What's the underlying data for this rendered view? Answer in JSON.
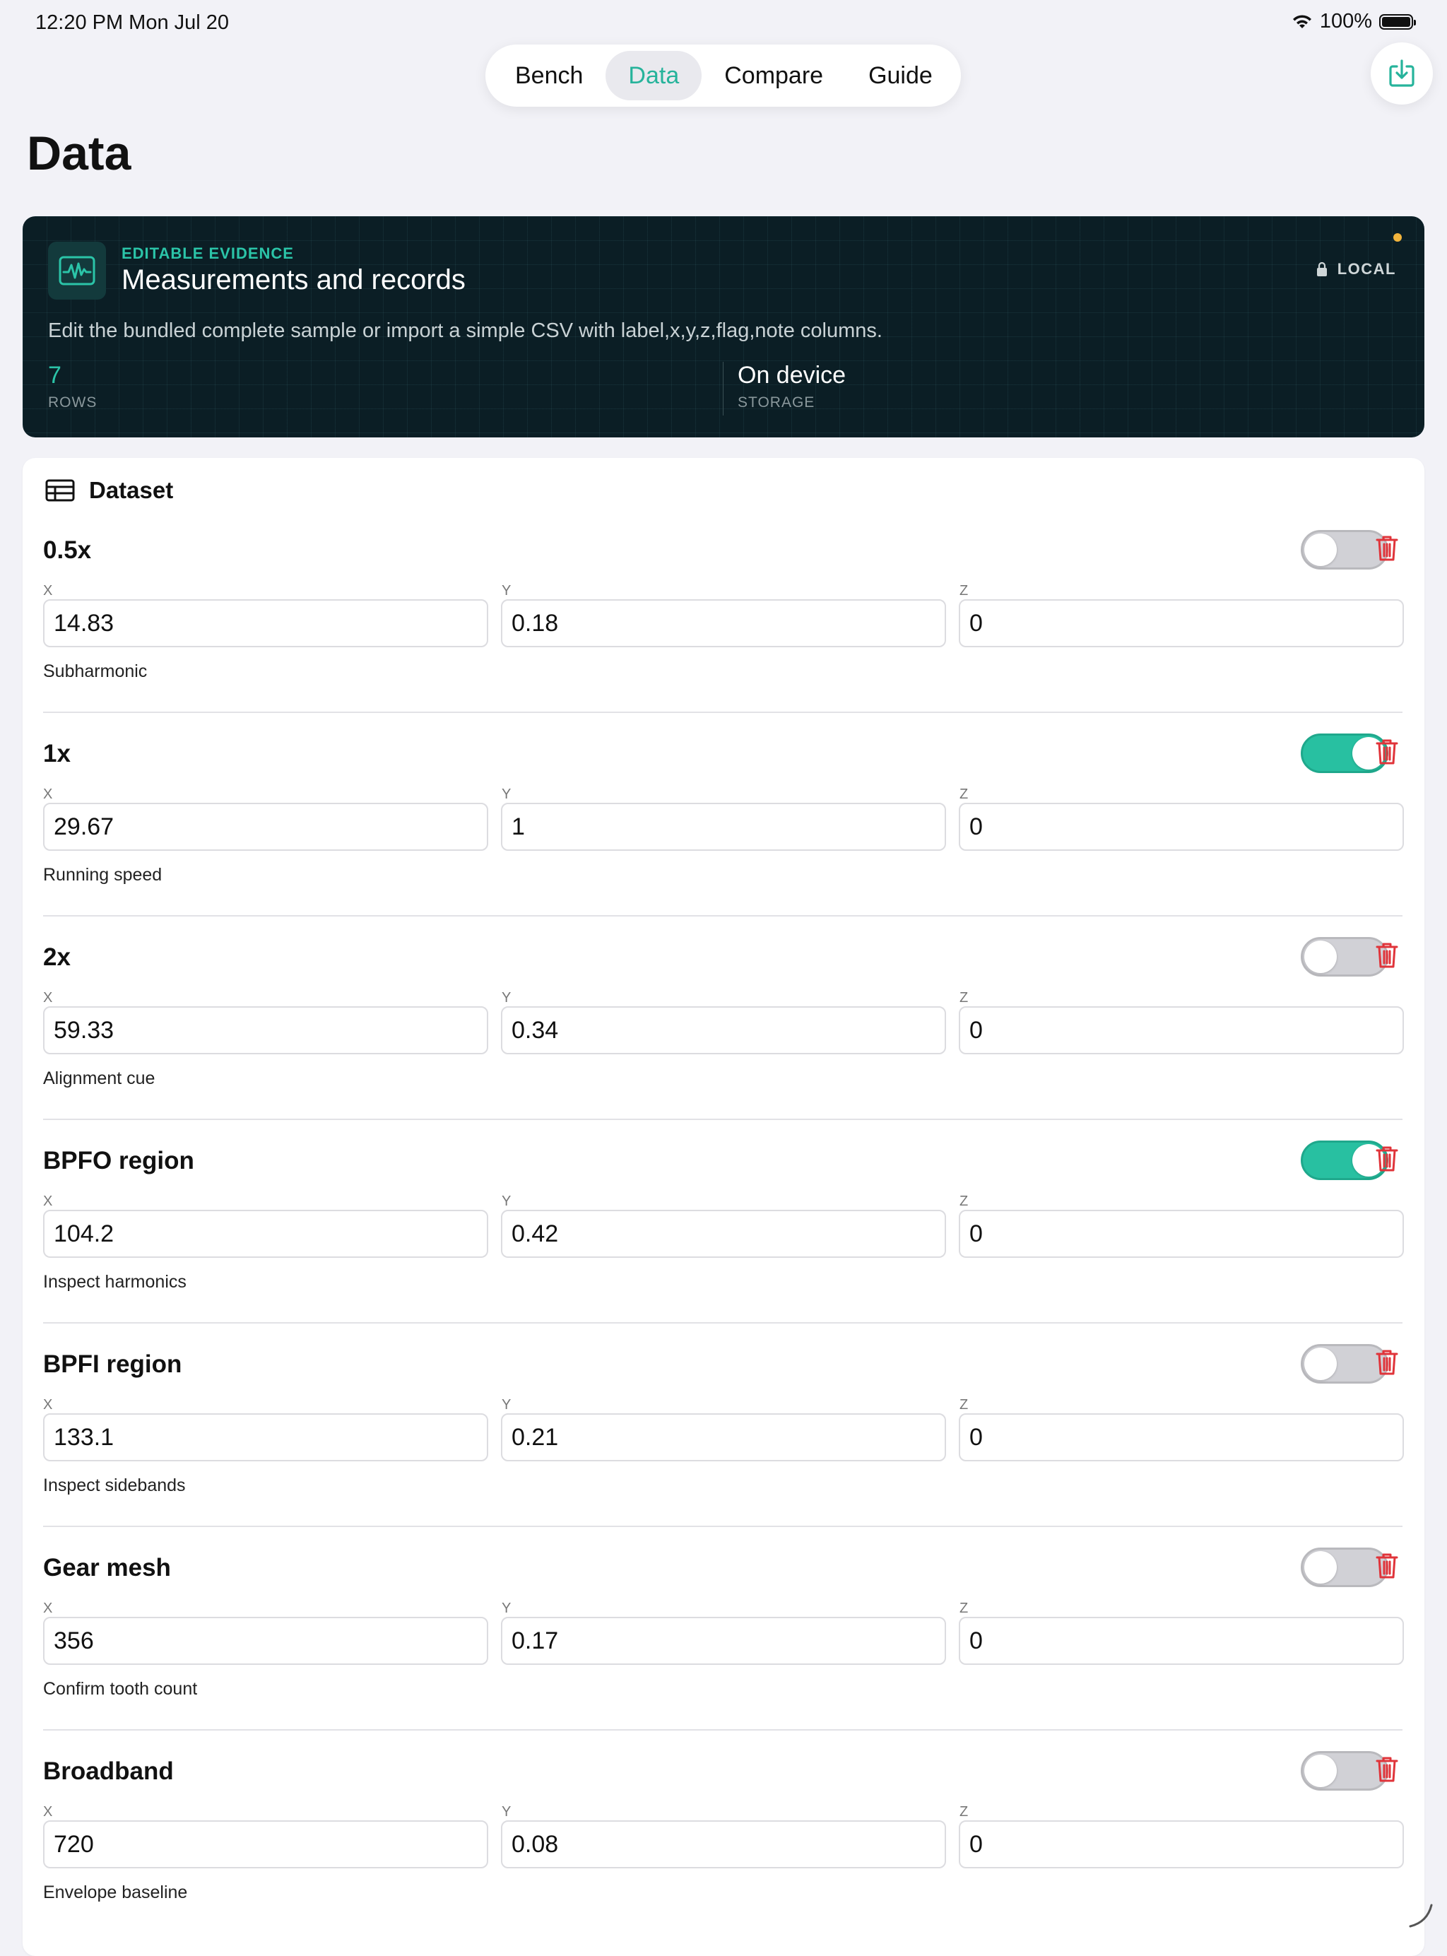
{
  "status_bar": {
    "time": "12:20 PM   Mon Jul 20",
    "battery": "100%"
  },
  "nav": {
    "tabs": [
      "Bench",
      "Data",
      "Compare",
      "Guide"
    ],
    "active": "Data"
  },
  "page": {
    "title": "Data"
  },
  "hero": {
    "eyebrow": "EDITABLE EVIDENCE",
    "title": "Measurements and records",
    "badge": "LOCAL",
    "description": "Edit the bundled complete sample or import a simple CSV with label,x,y,z,flag,note columns.",
    "stats": [
      {
        "value": "7",
        "label": "ROWS"
      },
      {
        "value": "On device",
        "label": "STORAGE"
      }
    ]
  },
  "dataset": {
    "title": "Dataset",
    "field_labels": {
      "x": "X",
      "y": "Y",
      "z": "Z"
    },
    "rows": [
      {
        "label": "0.5x",
        "x": "14.83",
        "y": "0.18",
        "z": "0",
        "flag": false,
        "note": "Subharmonic"
      },
      {
        "label": "1x",
        "x": "29.67",
        "y": "1",
        "z": "0",
        "flag": true,
        "note": "Running speed"
      },
      {
        "label": "2x",
        "x": "59.33",
        "y": "0.34",
        "z": "0",
        "flag": false,
        "note": "Alignment cue"
      },
      {
        "label": "BPFO region",
        "x": "104.2",
        "y": "0.42",
        "z": "0",
        "flag": true,
        "note": "Inspect harmonics"
      },
      {
        "label": "BPFI region",
        "x": "133.1",
        "y": "0.21",
        "z": "0",
        "flag": false,
        "note": "Inspect sidebands"
      },
      {
        "label": "Gear mesh",
        "x": "356",
        "y": "0.17",
        "z": "0",
        "flag": false,
        "note": "Confirm tooth count"
      },
      {
        "label": "Broadband",
        "x": "720",
        "y": "0.08",
        "z": "0",
        "flag": false,
        "note": "Envelope baseline"
      }
    ]
  },
  "colors": {
    "accent": "#26b39b",
    "hero_bg": "#0b1e25",
    "delete": "#e0343a",
    "toggle_on": "#28c0a1"
  }
}
